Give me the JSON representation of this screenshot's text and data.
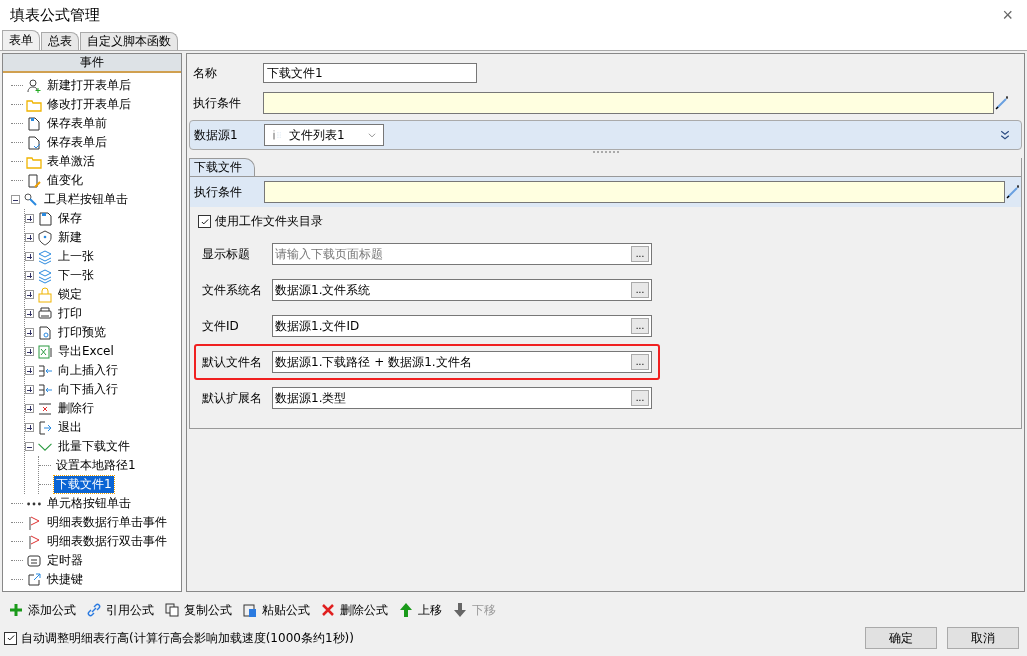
{
  "window": {
    "title": "填表公式管理",
    "close": "×"
  },
  "tabs": [
    {
      "label": "表单",
      "selected": true
    },
    {
      "label": "总表",
      "selected": false
    },
    {
      "label": "自定义脚本函数",
      "selected": false
    }
  ],
  "tree": {
    "header": "事件",
    "items": [
      {
        "label": "新建打开表单后",
        "selected": false
      },
      {
        "label": "修改打开表单后",
        "selected": false
      },
      {
        "label": "保存表单前",
        "selected": false
      },
      {
        "label": "保存表单后",
        "selected": false
      },
      {
        "label": "表单激活",
        "selected": false
      },
      {
        "label": "值变化",
        "selected": false
      },
      {
        "label": "工具栏按钮单击",
        "selected": false,
        "expanded": true,
        "children": [
          {
            "label": "保存",
            "selected": false,
            "expanded": false
          },
          {
            "label": "新建",
            "selected": false,
            "expanded": false
          },
          {
            "label": "上一张",
            "selected": false,
            "expanded": false
          },
          {
            "label": "下一张",
            "selected": false,
            "expanded": false
          },
          {
            "label": "锁定",
            "selected": false,
            "expanded": false
          },
          {
            "label": "打印",
            "selected": false,
            "expanded": false
          },
          {
            "label": "打印预览",
            "selected": false,
            "expanded": false
          },
          {
            "label": "导出Excel",
            "selected": false,
            "expanded": false
          },
          {
            "label": "向上插入行",
            "selected": false,
            "expanded": false
          },
          {
            "label": "向下插入行",
            "selected": false,
            "expanded": false
          },
          {
            "label": "删除行",
            "selected": false,
            "expanded": false
          },
          {
            "label": "退出",
            "selected": false,
            "expanded": false
          },
          {
            "label": "批量下载文件",
            "selected": false,
            "expanded": true,
            "children": [
              {
                "label": "设置本地路径1",
                "selected": false
              },
              {
                "label": "下载文件1",
                "selected": true
              }
            ]
          }
        ]
      },
      {
        "label": "单元格按钮单击",
        "selected": false
      },
      {
        "label": "明细表数据行单击事件",
        "selected": false
      },
      {
        "label": "明细表数据行双击事件",
        "selected": false
      },
      {
        "label": "定时器",
        "selected": false
      },
      {
        "label": "快捷键",
        "selected": false
      }
    ]
  },
  "editor": {
    "name_label": "名称",
    "name_value": "下载文件1",
    "condition_label": "执行条件",
    "datasource": {
      "label": "数据源1",
      "value": "文件列表1"
    },
    "subtab": "下载文件",
    "sub_condition_label": "执行条件",
    "work_folder": {
      "label": "使用工作文件夹目录",
      "checked": true
    },
    "fields": [
      {
        "label": "显示标题",
        "placeholder": "请输入下载页面标题",
        "button": "...",
        "highlighted": false
      },
      {
        "label": "文件系统名",
        "value": "数据源1.文件系统",
        "button": "...",
        "highlighted": false
      },
      {
        "label": "文件ID",
        "value": "数据源1.文件ID",
        "button": "...",
        "highlighted": false
      },
      {
        "label": "默认文件名",
        "value": "数据源1.下载路径  + 数据源1.文件名",
        "button": "...",
        "highlighted": true
      },
      {
        "label": "默认扩展名",
        "value": "数据源1.类型",
        "button": "...",
        "highlighted": false
      }
    ]
  },
  "toolbar": [
    {
      "label": "添加公式",
      "disabled": false
    },
    {
      "label": "引用公式",
      "disabled": false
    },
    {
      "label": "复制公式",
      "disabled": false
    },
    {
      "label": "粘贴公式",
      "disabled": false
    },
    {
      "label": "删除公式",
      "disabled": false
    },
    {
      "label": "上移",
      "disabled": false
    },
    {
      "label": "下移",
      "disabled": true
    }
  ],
  "footer": {
    "auto_height": {
      "label": "自动调整明细表行高(计算行高会影响加载速度(1000条约1秒))",
      "checked": true
    },
    "buttons": [
      "确定",
      "取消"
    ]
  }
}
